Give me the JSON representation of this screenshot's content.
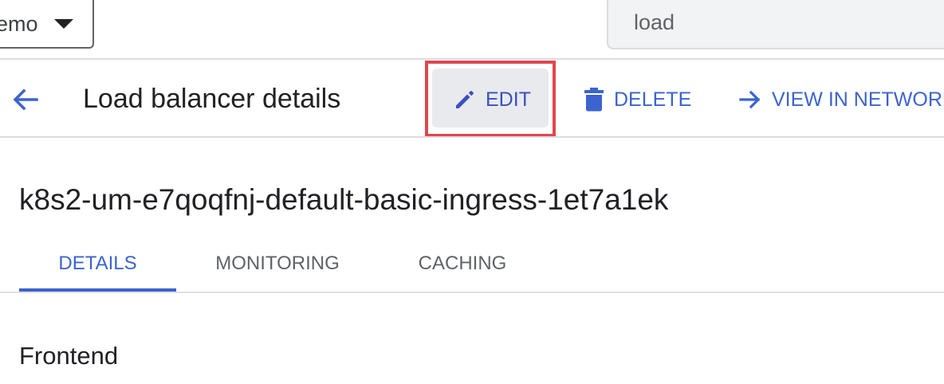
{
  "header": {
    "project_selector_label": "emo",
    "search_value": "load"
  },
  "action_bar": {
    "title": "Load balancer details",
    "edit_label": "EDIT",
    "delete_label": "DELETE",
    "view_in_network_label": "VIEW IN NETWORK"
  },
  "resource": {
    "name": "k8s2-um-e7qoqfnj-default-basic-ingress-1et7a1ek"
  },
  "tabs": [
    {
      "label": "DETAILS",
      "active": true
    },
    {
      "label": "MONITORING",
      "active": false
    },
    {
      "label": "CACHING",
      "active": false
    }
  ],
  "section": {
    "heading": "Frontend"
  },
  "icons": {
    "back": "arrow-back-icon",
    "edit": "pencil-icon",
    "delete": "trash-icon",
    "view_in_network": "arrow-forward-icon",
    "dropdown": "caret-down-icon"
  },
  "colors": {
    "accent": "#3c63cf",
    "highlight": "#e0474f",
    "edit_bg": "#e8eaed",
    "text": "#202124"
  }
}
